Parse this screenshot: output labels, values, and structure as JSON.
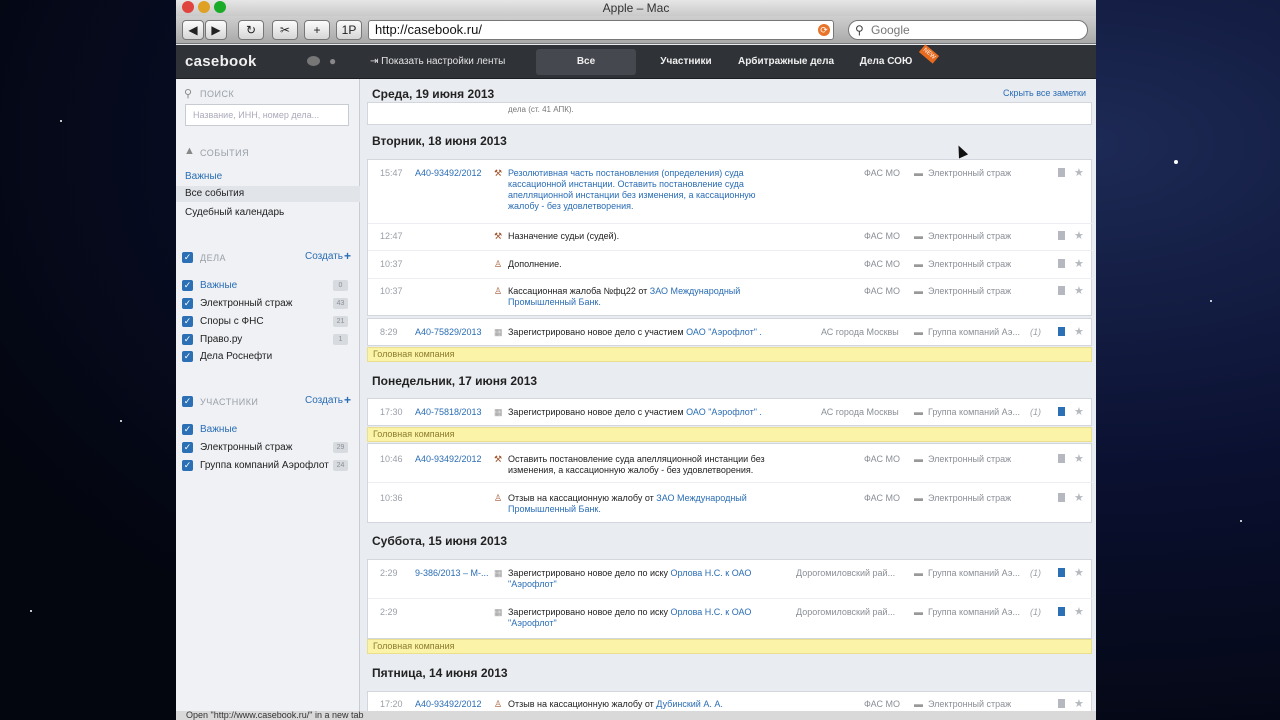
{
  "window": {
    "title": "Apple – Mac"
  },
  "browser": {
    "url": "http://casebook.ru/",
    "search_placeholder": "Google",
    "back": "◀",
    "forward": "▶",
    "reload": "↻",
    "snap": "✂",
    "add": "+",
    "onepw": "1P",
    "go_icon": "⟳"
  },
  "app": {
    "logo": "casebook",
    "feed_settings": "Показать настройки ленты",
    "tabs": [
      {
        "label": "Все",
        "active": true
      },
      {
        "label": "Участники"
      },
      {
        "label": "Арбитражные дела"
      },
      {
        "label": "Дела СОЮ"
      }
    ],
    "new_badge": "NEW",
    "hide_all": "Скрыть все заметки"
  },
  "sidebar": {
    "search_title": "ПОИСК",
    "search_placeholder": "Название, ИНН, номер дела...",
    "events_title": "СОБЫТИЯ",
    "events": [
      {
        "label": "Важные"
      },
      {
        "label": "Все события"
      },
      {
        "label": "Судебный календарь"
      }
    ],
    "cases_title": "ДЕЛА",
    "create": "Создать",
    "cases": [
      {
        "label": "Важные",
        "count": "0"
      },
      {
        "label": "Электронный страж",
        "count": "43"
      },
      {
        "label": "Споры с ФНС",
        "count": "21"
      },
      {
        "label": "Право.ру",
        "count": "1"
      },
      {
        "label": "Дела Роснефти",
        "count": ""
      }
    ],
    "participants_title": "УЧАСТНИКИ",
    "participants": [
      {
        "label": "Важные",
        "count": ""
      },
      {
        "label": "Электронный страж",
        "count": "29"
      },
      {
        "label": "Группа компаний Аэрофлот",
        "count": "24"
      }
    ]
  },
  "feed": {
    "d0": "Среда, 19 июня 2013",
    "d0_cut": "дела (ст. 41 АПК).",
    "d1": "Вторник, 18 июня 2013",
    "d2": "Понедельник, 17 июня 2013",
    "d3": "Суббота, 15 июня 2013",
    "d4": "Пятница, 14 июня 2013",
    "head_company": "Головная компания",
    "r1": {
      "t": "15:47",
      "c": "А40-93492/2012",
      "tx": "Резолютивная часть постановления (определения) суда кассационной инстанции. Оставить постановление суда апелляционной инстанции без изменения, а кассационную жалобу - без удовлетворения.",
      "ct": "ФАС МО",
      "pj": "Электронный страж"
    },
    "r2": {
      "t": "12:47",
      "tx": "Назначение судьи (судей).",
      "ct": "ФАС МО",
      "pj": "Электронный страж"
    },
    "r3": {
      "t": "10:37",
      "tx": "Дополнение.",
      "ct": "ФАС МО",
      "pj": "Электронный страж"
    },
    "r4": {
      "t": "10:37",
      "tx": "Кассационная жалоба №фц22 от ",
      "lnk": "ЗАО Международный Промышленный Банк.",
      "ct": "ФАС МО",
      "pj": "Электронный страж"
    },
    "r5": {
      "t": "8:29",
      "c": "А40-75829/2013",
      "tx": "Зарегистрировано новое дело с участием ",
      "lnk": "ОАО \"Аэрофлот\" .",
      "ct": "АС города Москвы",
      "pj": "Группа компаний Аэ...",
      "ttl": "(1)"
    },
    "r6": {
      "t": "17:30",
      "c": "А40-75818/2013",
      "tx": "Зарегистрировано новое дело с участием ",
      "lnk": "ОАО \"Аэрофлот\" .",
      "ct": "АС города Москвы",
      "pj": "Группа компаний Аэ...",
      "ttl": "(1)"
    },
    "r7": {
      "t": "10:46",
      "c": "А40-93492/2012",
      "tx": "Оставить постановление суда апелляционной инстанции без изменения, а кассационную жалобу - без удовлетворения.",
      "ct": "ФАС МО",
      "pj": "Электронный страж"
    },
    "r8": {
      "t": "10:36",
      "tx": "Отзыв на кассационную жалобу от ",
      "lnk": "ЗАО Международный Промышленный Банк.",
      "ct": "ФАС МО",
      "pj": "Электронный страж"
    },
    "r9": {
      "t": "2:29",
      "c": "9-386/2013 – М-...",
      "tx": "Зарегистрировано новое дело по иску ",
      "lnk": "Орлова Н.С. к ОАО \"Аэрофлот\"",
      "ct": "Дорогомиловский рай...",
      "pj": "Группа компаний Аэ...",
      "ttl": "(1)"
    },
    "r10": {
      "t": "2:29",
      "tx": "Зарегистрировано новое дело по иску ",
      "lnk": "Орлова Н.С. к ОАО \"Аэрофлот\"",
      "ct": "Дорогомиловский рай...",
      "pj": "Группа компаний Аэ...",
      "ttl": "(1)"
    },
    "r11": {
      "t": "17:20",
      "c": "А40-93492/2012",
      "tx": "Отзыв на кассационную жалобу от ",
      "lnk": "Дубинский А. А.",
      "ct": "ФАС МО",
      "pj": "Электронный страж"
    }
  },
  "status_bar": "Open \"http://www.casebook.ru/\" in a new tab",
  "colors": {
    "accent": "#2a6db5",
    "highlight": "#fbf3a8",
    "topbar": "#2f3237"
  }
}
